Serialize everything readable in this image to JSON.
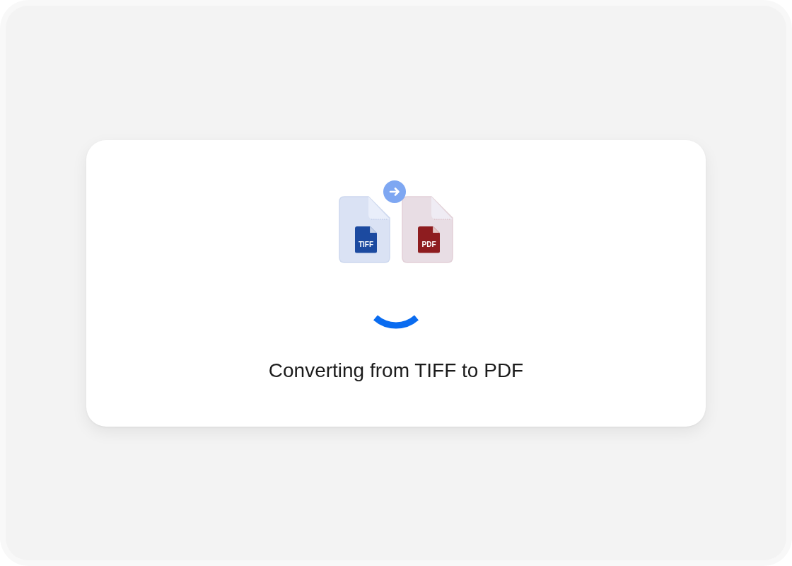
{
  "conversion_card": {
    "files": [
      {
        "label": "TIFF",
        "color": "#1c4aa0"
      },
      {
        "label": "PDF",
        "color": "#8e1c1f"
      }
    ],
    "status": "Converting from TIFF to PDF"
  }
}
